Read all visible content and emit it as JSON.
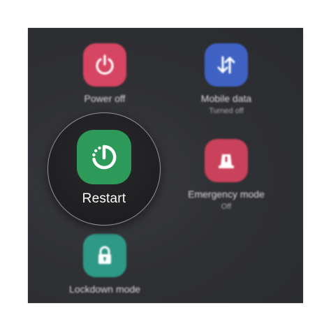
{
  "menu": {
    "items": [
      {
        "id": "power-off",
        "label": "Power off",
        "sublabel": "",
        "icon": "power-icon",
        "color": "#d64561"
      },
      {
        "id": "mobile-data",
        "label": "Mobile data",
        "sublabel": "Turned off",
        "icon": "data-arrows-icon",
        "color": "#3f62c4"
      },
      {
        "id": "emergency-mode",
        "label": "Emergency mode",
        "sublabel": "Off",
        "icon": "emergency-light-icon",
        "color": "#c9415a"
      },
      {
        "id": "lockdown-mode",
        "label": "Lockdown mode",
        "sublabel": "",
        "icon": "lock-icon",
        "color": "#2f9988"
      }
    ],
    "highlighted": {
      "id": "restart",
      "label": "Restart",
      "icon": "restart-icon",
      "color": "#2e9a5a"
    }
  }
}
